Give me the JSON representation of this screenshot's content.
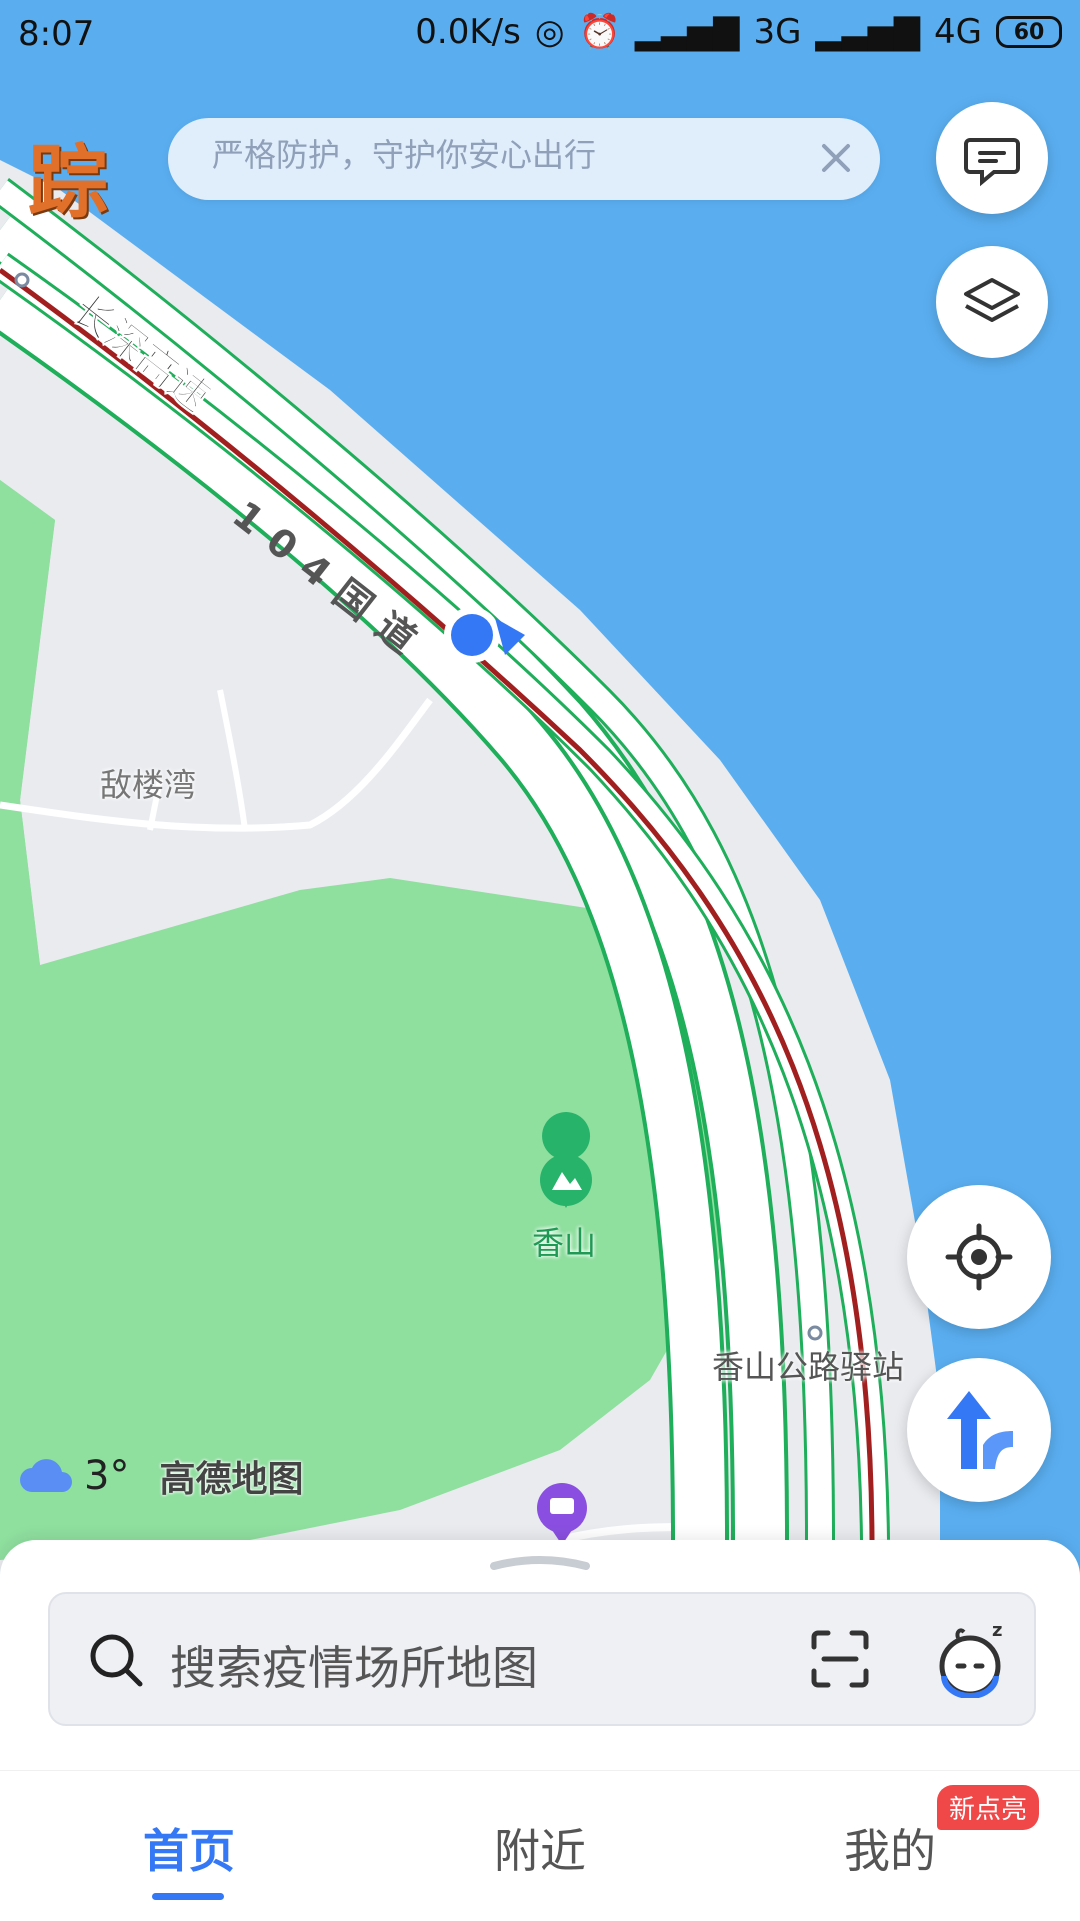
{
  "status_bar": {
    "time": "8:07",
    "net_speed": "0.0K/s",
    "sim1_label": "3G",
    "sim2_label": "4G",
    "battery": "60"
  },
  "top": {
    "logo_text": "踪",
    "banner_text": "严格防护，守护你安心出行"
  },
  "map": {
    "road_labels": [
      "长深高速",
      "104国道"
    ],
    "places": [
      "敌楼湾",
      "香山",
      "香山公路驿站"
    ],
    "colors": {
      "water": "#5aaef0",
      "land": "#e9ebef",
      "park": "#8fdf9f",
      "traffic_green": "#1fae5a",
      "traffic_red": "#a21f1f",
      "accent": "#3478f6"
    }
  },
  "weather": {
    "temp": "3°",
    "brand": "高德地图"
  },
  "search": {
    "placeholder": "搜索疫情场所地图"
  },
  "tabs": [
    {
      "label": "首页",
      "active": true
    },
    {
      "label": "附近",
      "active": false
    },
    {
      "label": "我的",
      "active": false
    }
  ],
  "badge": "新点亮",
  "icons": [
    "message-icon",
    "layers-icon",
    "locate-icon",
    "navigate-icon",
    "search-icon",
    "scan-icon",
    "assistant-icon",
    "close-icon",
    "weather-icon",
    "shop-poi-icon",
    "mountain-poi-icon"
  ]
}
